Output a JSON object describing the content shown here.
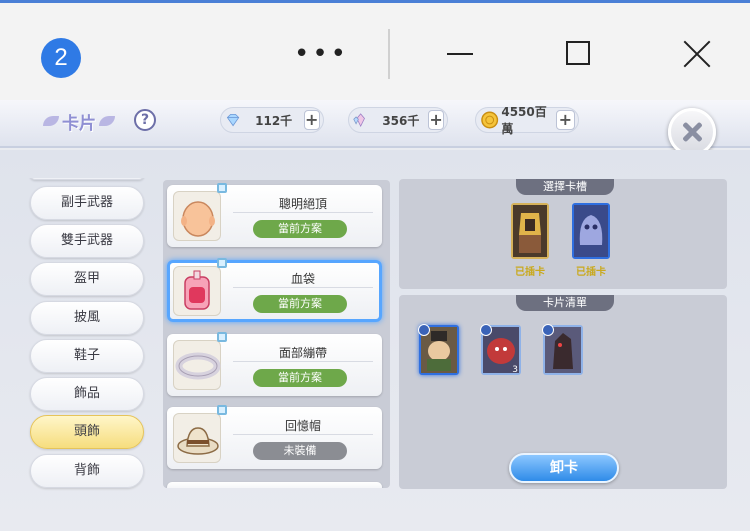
{
  "window": {
    "tab_number": "2",
    "more_label": "•••"
  },
  "topbar": {
    "title": "卡片",
    "help_label": "?",
    "resources": [
      {
        "icon": "diamond-icon",
        "value": "112千",
        "plus": "+"
      },
      {
        "icon": "crystal-icon",
        "value": "356千",
        "plus": "+"
      },
      {
        "icon": "coin-icon",
        "value": "4550百萬",
        "plus": "+"
      }
    ]
  },
  "sidebar": {
    "items": [
      "副手武器",
      "雙手武器",
      "盔甲",
      "披風",
      "鞋子",
      "飾品",
      "頭飾",
      "背飾"
    ],
    "active_index": 6
  },
  "equipment": [
    {
      "name": "聰明絕頂",
      "status": "當前方案"
    },
    {
      "name": "血袋",
      "status": "當前方案"
    },
    {
      "name": "面部繃帶",
      "status": "當前方案"
    },
    {
      "name": "回憶帽",
      "status": "未裝備"
    }
  ],
  "slots": {
    "title": "選擇卡槽",
    "items": [
      {
        "label": "已插卡"
      },
      {
        "label": "已插卡"
      }
    ]
  },
  "card_list": {
    "title": "卡片清單",
    "count_label": "3",
    "unload_label": "卸卡"
  },
  "colors": {
    "accent_blue": "#2f7ae5",
    "active_green": "#6ea84a",
    "inactive_grey": "#8b8d93",
    "gold_text": "#c9a91e",
    "active_tab": "#f6dd7e"
  }
}
